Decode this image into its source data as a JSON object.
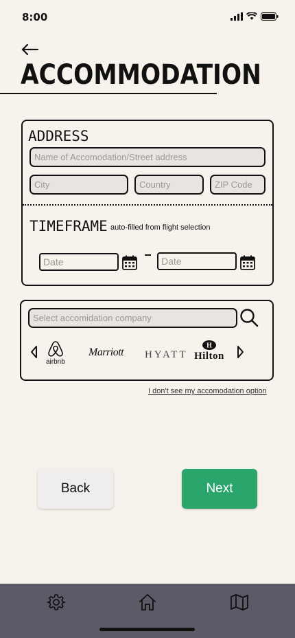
{
  "status_bar": {
    "time": "8:00"
  },
  "header": {
    "title": "ACCOMMODATION",
    "back_icon": "back-arrow-icon"
  },
  "address": {
    "label": "ADDRESS",
    "street_placeholder": "Name of Accomodation/Street address",
    "city_placeholder": "City",
    "country_placeholder": "Country",
    "zip_placeholder": "ZIP Code"
  },
  "timeframe": {
    "label": "TIMEFRAME",
    "note": "auto-filled from flight selection",
    "start_placeholder": "Date",
    "end_placeholder": "Date"
  },
  "company": {
    "search_placeholder": "Select accomidation company",
    "logos": [
      {
        "name": "airbnb",
        "text": "airbnb"
      },
      {
        "name": "marriott",
        "text": "Marriott"
      },
      {
        "name": "hyatt",
        "text": "HYATT"
      },
      {
        "name": "hilton",
        "text": "Hilton"
      }
    ],
    "missing_link": "I don't see my accomodation option"
  },
  "buttons": {
    "back": "Back",
    "next": "Next"
  },
  "colors": {
    "background": "#f7f3ec",
    "next_button": "#2aa56c",
    "nav_bar": "#5b5a66"
  },
  "bottom_nav": {
    "items": [
      "gear-icon",
      "home-icon",
      "map-icon"
    ]
  }
}
